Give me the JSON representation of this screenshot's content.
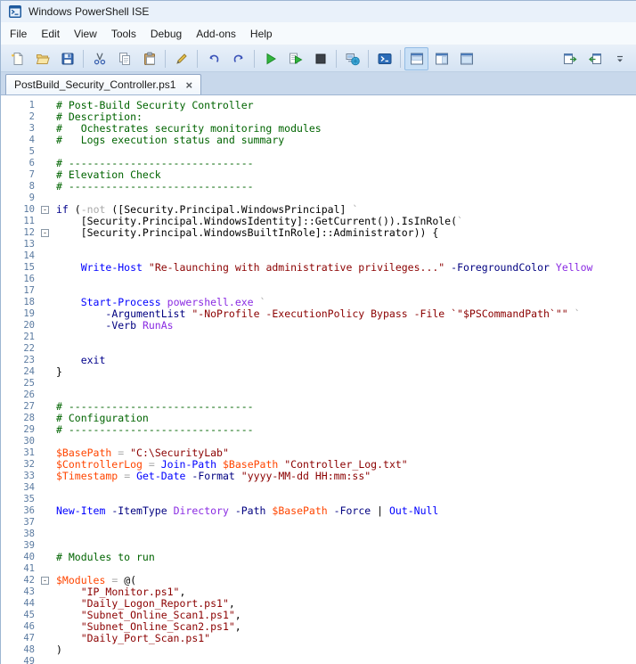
{
  "window": {
    "title": "Windows PowerShell ISE"
  },
  "menus": [
    "File",
    "Edit",
    "View",
    "Tools",
    "Debug",
    "Add-ons",
    "Help"
  ],
  "toolbar": [
    {
      "name": "new-script"
    },
    {
      "name": "open-script"
    },
    {
      "name": "save-script"
    },
    {
      "name": "sep"
    },
    {
      "name": "cut"
    },
    {
      "name": "copy"
    },
    {
      "name": "paste"
    },
    {
      "name": "sep"
    },
    {
      "name": "clear-console-pane"
    },
    {
      "name": "sep"
    },
    {
      "name": "undo"
    },
    {
      "name": "redo"
    },
    {
      "name": "sep"
    },
    {
      "name": "run-script"
    },
    {
      "name": "run-selection"
    },
    {
      "name": "stop-operation"
    },
    {
      "name": "sep"
    },
    {
      "name": "new-remote-powershell-tab"
    },
    {
      "name": "sep"
    },
    {
      "name": "start-powershell"
    },
    {
      "name": "sep"
    },
    {
      "name": "show-script-pane-top",
      "pressed": true
    },
    {
      "name": "show-script-pane-right"
    },
    {
      "name": "show-script-pane-maximized"
    },
    {
      "name": "spacer"
    },
    {
      "name": "show-command-addon"
    },
    {
      "name": "show-script-pane"
    },
    {
      "name": "toolbar-overflow"
    }
  ],
  "tab": {
    "label": "PostBuild_Security_Controller.ps1",
    "close_glyph": "×"
  },
  "colors": {
    "comment": "#006400",
    "keyword": "#00008B",
    "command": "#0000FF",
    "parameter": "#000080",
    "argument": "#8A2BE2",
    "string": "#8B0000",
    "variable": "#FF4500",
    "operator": "#A9A9A9",
    "default": "#000000",
    "linenumber": "#5B7BA1",
    "accent": "#2B6CB8"
  },
  "editor": {
    "lines": [
      {
        "n": 1,
        "segs": [
          [
            "c",
            "# Post-Build Security Controller"
          ]
        ]
      },
      {
        "n": 2,
        "segs": [
          [
            "c",
            "# Description:"
          ]
        ]
      },
      {
        "n": 3,
        "segs": [
          [
            "c",
            "#   Ochestrates security monitoring modules"
          ]
        ]
      },
      {
        "n": 4,
        "segs": [
          [
            "c",
            "#   Logs execution status and summary"
          ]
        ]
      },
      {
        "n": 5,
        "segs": []
      },
      {
        "n": 6,
        "segs": [
          [
            "c",
            "# ------------------------------"
          ]
        ]
      },
      {
        "n": 7,
        "segs": [
          [
            "c",
            "# Elevation Check"
          ]
        ]
      },
      {
        "n": 8,
        "segs": [
          [
            "c",
            "# ------------------------------"
          ]
        ]
      },
      {
        "n": 9,
        "segs": []
      },
      {
        "n": 10,
        "fold": true,
        "segs": [
          [
            "k",
            "if"
          ],
          [
            "d",
            " ("
          ],
          [
            "o",
            "-not"
          ],
          [
            "d",
            " ([Security.Principal.WindowsPrincipal] "
          ],
          [
            "o",
            "`"
          ]
        ]
      },
      {
        "n": 11,
        "segs": [
          [
            "d",
            "    [Security.Principal.WindowsIdentity]::GetCurrent()).IsInRole("
          ],
          [
            "o",
            "`"
          ]
        ]
      },
      {
        "n": 12,
        "fold": true,
        "segs": [
          [
            "d",
            "    [Security.Principal.WindowsBuiltInRole]::Administrator)) {"
          ]
        ]
      },
      {
        "n": 13,
        "segs": []
      },
      {
        "n": 14,
        "segs": []
      },
      {
        "n": 15,
        "segs": [
          [
            "d",
            "    "
          ],
          [
            "cm",
            "Write-Host"
          ],
          [
            "d",
            " "
          ],
          [
            "s",
            "\"Re-launching with administrative privileges...\""
          ],
          [
            "d",
            " "
          ],
          [
            "p",
            "-ForegroundColor"
          ],
          [
            "d",
            " "
          ],
          [
            "a",
            "Yellow"
          ]
        ]
      },
      {
        "n": 16,
        "segs": []
      },
      {
        "n": 17,
        "segs": []
      },
      {
        "n": 18,
        "segs": [
          [
            "d",
            "    "
          ],
          [
            "cm",
            "Start-Process"
          ],
          [
            "d",
            " "
          ],
          [
            "a",
            "powershell.exe"
          ],
          [
            "d",
            " "
          ],
          [
            "o",
            "`"
          ]
        ]
      },
      {
        "n": 19,
        "segs": [
          [
            "d",
            "        "
          ],
          [
            "p",
            "-ArgumentList"
          ],
          [
            "d",
            " "
          ],
          [
            "s",
            "\"-NoProfile -ExecutionPolicy Bypass -File `\"$PSCommandPath`\"\""
          ],
          [
            "d",
            " "
          ],
          [
            "o",
            "`"
          ]
        ]
      },
      {
        "n": 20,
        "segs": [
          [
            "d",
            "        "
          ],
          [
            "p",
            "-Verb"
          ],
          [
            "d",
            " "
          ],
          [
            "a",
            "RunAs"
          ]
        ]
      },
      {
        "n": 21,
        "segs": []
      },
      {
        "n": 22,
        "segs": []
      },
      {
        "n": 23,
        "segs": [
          [
            "d",
            "    "
          ],
          [
            "k",
            "exit"
          ]
        ]
      },
      {
        "n": 24,
        "segs": [
          [
            "d",
            "}"
          ]
        ]
      },
      {
        "n": 25,
        "segs": []
      },
      {
        "n": 26,
        "segs": []
      },
      {
        "n": 27,
        "segs": [
          [
            "c",
            "# ------------------------------"
          ]
        ]
      },
      {
        "n": 28,
        "segs": [
          [
            "c",
            "# Configuration"
          ]
        ]
      },
      {
        "n": 29,
        "segs": [
          [
            "c",
            "# ------------------------------"
          ]
        ]
      },
      {
        "n": 30,
        "segs": []
      },
      {
        "n": 31,
        "segs": [
          [
            "v",
            "$BasePath"
          ],
          [
            "d",
            " "
          ],
          [
            "o",
            "="
          ],
          [
            "d",
            " "
          ],
          [
            "s",
            "\"C:\\SecurityLab\""
          ]
        ]
      },
      {
        "n": 32,
        "segs": [
          [
            "v",
            "$ControllerLog"
          ],
          [
            "d",
            " "
          ],
          [
            "o",
            "="
          ],
          [
            "d",
            " "
          ],
          [
            "cm",
            "Join-Path"
          ],
          [
            "d",
            " "
          ],
          [
            "v",
            "$BasePath"
          ],
          [
            "d",
            " "
          ],
          [
            "s",
            "\"Controller_Log.txt\""
          ]
        ]
      },
      {
        "n": 33,
        "segs": [
          [
            "v",
            "$Timestamp"
          ],
          [
            "d",
            " "
          ],
          [
            "o",
            "="
          ],
          [
            "d",
            " "
          ],
          [
            "cm",
            "Get-Date"
          ],
          [
            "d",
            " "
          ],
          [
            "p",
            "-Format"
          ],
          [
            "d",
            " "
          ],
          [
            "s",
            "\"yyyy-MM-dd HH:mm:ss\""
          ]
        ]
      },
      {
        "n": 34,
        "segs": []
      },
      {
        "n": 35,
        "segs": []
      },
      {
        "n": 36,
        "segs": [
          [
            "cm",
            "New-Item"
          ],
          [
            "d",
            " "
          ],
          [
            "p",
            "-ItemType"
          ],
          [
            "d",
            " "
          ],
          [
            "a",
            "Directory"
          ],
          [
            "d",
            " "
          ],
          [
            "p",
            "-Path"
          ],
          [
            "d",
            " "
          ],
          [
            "v",
            "$BasePath"
          ],
          [
            "d",
            " "
          ],
          [
            "p",
            "-Force"
          ],
          [
            "d",
            " | "
          ],
          [
            "cm",
            "Out-Null"
          ]
        ]
      },
      {
        "n": 37,
        "segs": []
      },
      {
        "n": 38,
        "segs": []
      },
      {
        "n": 39,
        "segs": []
      },
      {
        "n": 40,
        "segs": [
          [
            "c",
            "# Modules to run"
          ]
        ]
      },
      {
        "n": 41,
        "segs": []
      },
      {
        "n": 42,
        "fold": true,
        "segs": [
          [
            "v",
            "$Modules"
          ],
          [
            "d",
            " "
          ],
          [
            "o",
            "="
          ],
          [
            "d",
            " @("
          ]
        ]
      },
      {
        "n": 43,
        "segs": [
          [
            "d",
            "    "
          ],
          [
            "s",
            "\"IP_Monitor.ps1\""
          ],
          [
            "d",
            ","
          ]
        ]
      },
      {
        "n": 44,
        "segs": [
          [
            "d",
            "    "
          ],
          [
            "s",
            "\"Daily_Logon_Report.ps1\""
          ],
          [
            "d",
            ","
          ]
        ]
      },
      {
        "n": 45,
        "segs": [
          [
            "d",
            "    "
          ],
          [
            "s",
            "\"Subnet_Online_Scan1.ps1\""
          ],
          [
            "d",
            ","
          ]
        ]
      },
      {
        "n": 46,
        "segs": [
          [
            "d",
            "    "
          ],
          [
            "s",
            "\"Subnet_Online_Scan2.ps1\""
          ],
          [
            "d",
            ","
          ]
        ]
      },
      {
        "n": 47,
        "segs": [
          [
            "d",
            "    "
          ],
          [
            "s",
            "\"Daily_Port_Scan.ps1\""
          ]
        ]
      },
      {
        "n": 48,
        "segs": [
          [
            "d",
            ")"
          ]
        ]
      },
      {
        "n": 49,
        "segs": []
      }
    ]
  }
}
